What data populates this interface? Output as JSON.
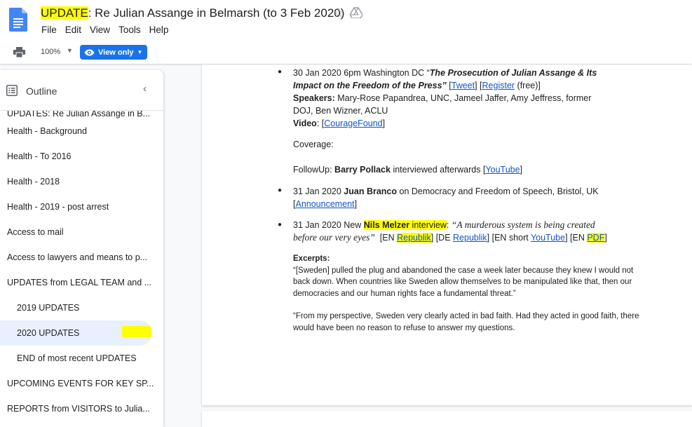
{
  "doc": {
    "title_highlight": "UPDATE",
    "title_rest": ": Re Julian Assange in Belmarsh (to 3 Feb 2020)"
  },
  "menu": [
    "File",
    "Edit",
    "View",
    "Tools",
    "Help"
  ],
  "toolbar": {
    "zoom": "100%",
    "view_only": "View only"
  },
  "outline": {
    "label": "Outline",
    "items": [
      "UPDATES: Re Julian Assange in B...",
      "Health - Background",
      "Health - To 2016",
      "Health - 2018",
      "Health - 2019 - post arrest",
      "Access to mail",
      "Access to lawyers and means to p...",
      "UPDATES from LEGAL TEAM and ...",
      "2019 UPDATES",
      "2020 UPDATES",
      "END of most recent UPDATES",
      "UPCOMING EVENTS FOR KEY SP...",
      "REPORTS from VISITORS to Julia..."
    ]
  },
  "content": {
    "e1": {
      "date": "30 Jan 2020 6pm Washington DC “",
      "title_line1": "The Prosecution of Julian Assange & Its",
      "title_line2": "Impact on the Freedom of the Press”",
      "tweet": "Tweet",
      "register": "Register",
      "free": " (free)]",
      "speakers_label": "Speakers:",
      "speakers_line1": " Mary-Rose Papandrea, UNC,  Jameel Jaffer, Amy Jeffress, former",
      "speakers_line2": "DOJ, Ben Wizner, ACLU",
      "video_label": "Video",
      "video_link": "CourageFound",
      "coverage": "Coverage:",
      "followup_label": "FollowUp: ",
      "followup_name": "Barry Pollack",
      "followup_text": " interviewed afterwards [",
      "youtube": "YouTube"
    },
    "e2": {
      "date": "31 Jan 2020 ",
      "name": "Juan Branco",
      "text": " on Democracy and Freedom of Speech, Bristol, UK",
      "announcement": "Announcement"
    },
    "e3": {
      "date": "31 Jan 2020 New ",
      "name": "Nils Melzer",
      "interview": " interview",
      "quote_line1": "“A murderous system is being created",
      "quote_line2": "before our very eyes”",
      "en_republik": "Republik",
      "de_republik": "Republik",
      "en_youtube": "YouTube",
      "pdf": "PDF",
      "excerpts_label": "Excerpts:",
      "excerpt1": "“[Sweden] pulled the plug and abandoned the case a week later because they knew I would not back down. When countries like Sweden allow themselves to be manipulated like that, then our democracies and our human rights face a fundamental threat.”",
      "excerpt2": "“From my perspective, Sweden very clearly acted in bad faith. Had they acted in good faith, there would have been no reason to refuse to answer my questions."
    }
  }
}
